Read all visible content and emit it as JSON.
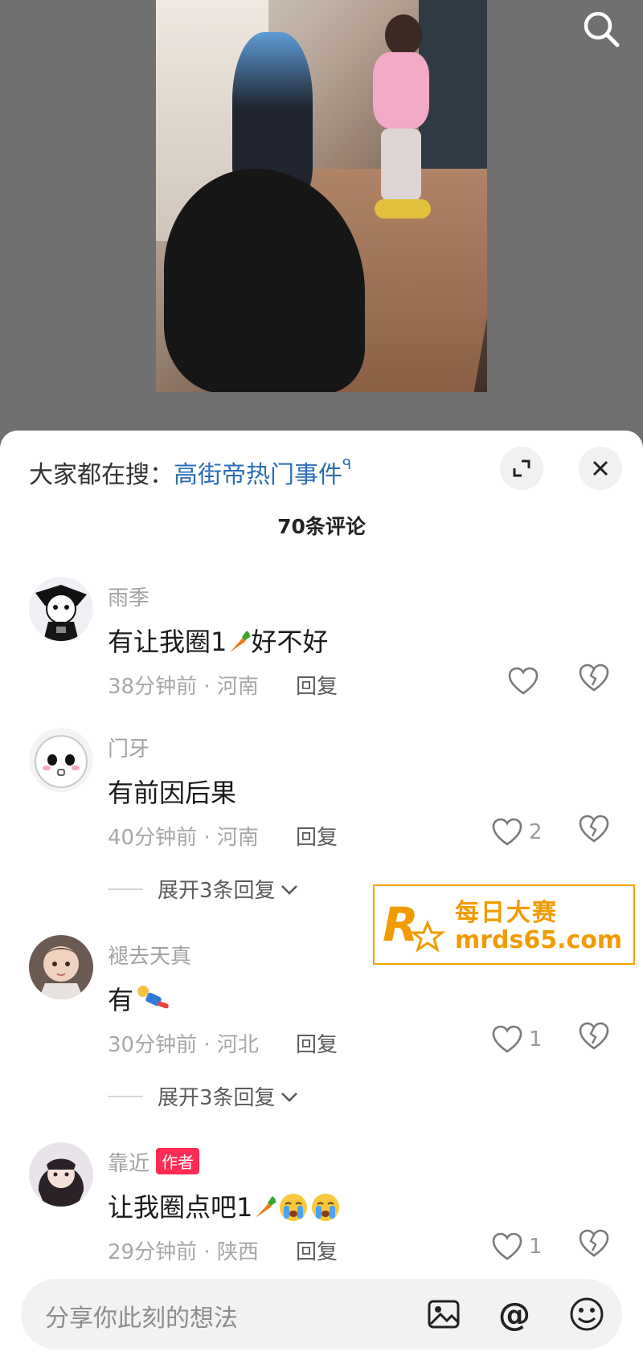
{
  "search": {
    "prefix": "大家都在搜：",
    "keyword": "高街帝热门事件",
    "magnifier": "ᑫ"
  },
  "comments_title": "70条评论",
  "comments": [
    {
      "username": "雨季",
      "text": "有让我圈1",
      "text_suffix": "好不好",
      "meta": "38分钟前 · 河南",
      "reply": "回复",
      "likes": "",
      "avatar_icon": "cartoon-avatar"
    },
    {
      "username": "门牙",
      "text": "有前因后果",
      "meta": "40分钟前 · 河南",
      "reply": "回复",
      "likes": "2",
      "expand": "展开3条回复",
      "avatar_icon": "white-blob-avatar"
    },
    {
      "username": "褪去天真",
      "text": "有",
      "meta": "30分钟前 · 河北",
      "reply": "回复",
      "likes": "1",
      "expand": "展开3条回复",
      "avatar_icon": "photo-avatar"
    },
    {
      "username": "靠近",
      "author_tag": "作者",
      "text": "让我圈点吧1",
      "meta": "29分钟前 · 陕西",
      "reply": "回复",
      "likes": "1",
      "avatar_icon": "photo-avatar"
    }
  ],
  "watermark": {
    "title": "每日大赛",
    "url": "mrds65.com"
  },
  "input": {
    "placeholder": "分享你此刻的想法"
  },
  "icons": [
    "search-icon",
    "expand-icon",
    "close-icon",
    "heart-icon",
    "broken-heart-icon",
    "image-icon",
    "at-icon",
    "emoji-icon"
  ],
  "colors": {
    "accent_link": "#2a6fb5",
    "author_tag": "#fe2c55",
    "watermark": "#f19b00"
  }
}
